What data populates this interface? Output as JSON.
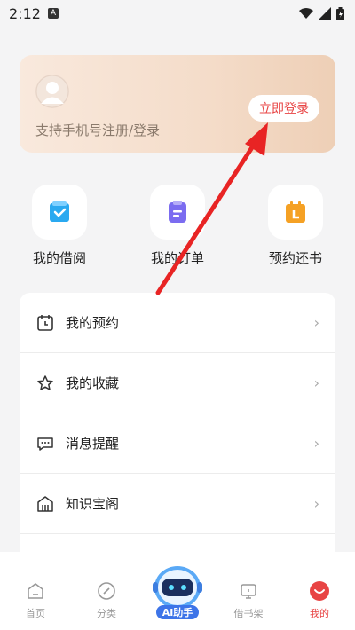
{
  "status_bar": {
    "time": "2:12",
    "notif_glyph": "A",
    "icons": [
      "wifi-icon",
      "signal-icon",
      "battery-icon"
    ]
  },
  "login_card": {
    "hint": "支持手机号注册/登录",
    "button_label": "立即登录"
  },
  "quick_actions": [
    {
      "label": "我的借阅",
      "icon": "borrow-book-icon",
      "color": "#2aa9f0"
    },
    {
      "label": "我的订单",
      "icon": "clipboard-order-icon",
      "color": "#7b6cf0"
    },
    {
      "label": "预约还书",
      "icon": "calendar-return-icon",
      "color": "#f5a124"
    }
  ],
  "menu": [
    {
      "label": "我的预约",
      "icon": "calendar-clock-icon"
    },
    {
      "label": "我的收藏",
      "icon": "star-icon"
    },
    {
      "label": "消息提醒",
      "icon": "message-icon"
    },
    {
      "label": "知识宝阁",
      "icon": "building-icon"
    }
  ],
  "tabbar": {
    "items": [
      {
        "label": "首页",
        "icon": "home-icon"
      },
      {
        "label": "分类",
        "icon": "compass-icon"
      },
      {
        "label": "借书架",
        "icon": "bookshelf-tv-icon"
      },
      {
        "label": "我的",
        "icon": "profile-smile-icon"
      }
    ],
    "ai_label": "AI助手",
    "active_color": "#e84444"
  }
}
